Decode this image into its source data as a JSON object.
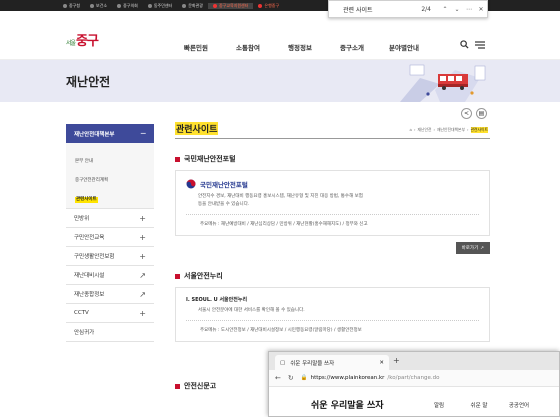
{
  "topbar": {
    "links": [
      {
        "label": "중구청",
        "highlight": false
      },
      {
        "label": "보건소",
        "highlight": false
      },
      {
        "label": "중구의회",
        "highlight": false
      },
      {
        "label": "동주민센터",
        "highlight": false
      },
      {
        "label": "문화관광",
        "highlight": false
      },
      {
        "label": "중구교육지원센터",
        "highlight": true
      },
      {
        "label": "은행중구",
        "highlight": true
      }
    ]
  },
  "findbar": {
    "query": "관련 사이트",
    "count": "2/4"
  },
  "header": {
    "logo_prefix": "서울",
    "logo_text": "중구",
    "nav": [
      "빠른민원",
      "소통참여",
      "행정정보",
      "중구소개",
      "분야별안내"
    ]
  },
  "banner": {
    "title": "재난안전"
  },
  "sidebar": {
    "head": "재난안전대책본부",
    "sub": [
      {
        "label": "본부 안내",
        "active": false
      },
      {
        "label": "중구안전관리계획",
        "active": false
      },
      {
        "label": "관련사이트",
        "active": true
      }
    ],
    "items": [
      {
        "label": "민방위",
        "suffix": "+"
      },
      {
        "label": "구민안전교육",
        "suffix": "+"
      },
      {
        "label": "구민생활안전보험",
        "suffix": "+"
      },
      {
        "label": "재난대비시설",
        "suffix": "↗"
      },
      {
        "label": "재난종합정보",
        "suffix": "↗"
      },
      {
        "label": "CCTV",
        "suffix": "+"
      },
      {
        "label": "안심귀가",
        "suffix": ""
      }
    ]
  },
  "content": {
    "page_title": "관련사이트",
    "breadcrumb": [
      "⌂",
      "재난안전",
      "재난안전대책본부",
      "관련사이트"
    ],
    "cards": [
      {
        "title": "국민재난안전포털",
        "brand": "국민재난안전포털",
        "desc": [
          "안전지수 경보, 재난대비 행동요령 홍보시스템, 재난유형 및 지진 대응 방법, 통수해 보험",
          "등을 안내받을 수 있습니다."
        ],
        "note": "주요메뉴 : 재난예방대비 / 재난심리상담 / 민방위 / 재난현황(홍수재해지도) / 정부와 신고",
        "button": "바로가기"
      },
      {
        "title": "서울안전누리",
        "brand": "I. SEOUL. U  서울안전누리",
        "desc": [
          "서울시 안전분야에 대한 서비스를 확인해 볼 수 있습니다."
        ],
        "note": "주요메뉴 : 도시안전정보 / 재난대비시설정보 / 시민행동요령(알림마당) / 생활안전정보",
        "button": ""
      },
      {
        "title": "안전신문고",
        "brand": "",
        "desc": [],
        "note": "",
        "button": ""
      }
    ]
  },
  "overlay": {
    "tab_title": "쉬운 우리말을 쓰자",
    "url_host": "https://www.plainkorean.kr",
    "url_path": "/ko/part/change.do",
    "site_logo": "쉬운 우리말을 쓰자",
    "site_nav": [
      "알림",
      "쉬운 말",
      "공공언어"
    ]
  },
  "colors": {
    "topbar": "#222222",
    "sidebar_head": "#3e4a9a",
    "highlight": "#ffe12e",
    "accent": "#c8102e"
  }
}
